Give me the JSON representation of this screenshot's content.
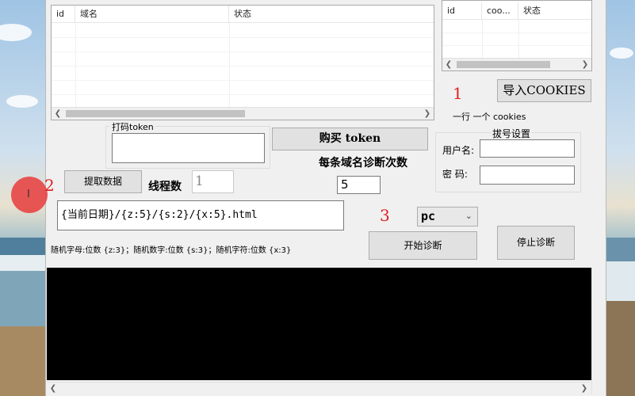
{
  "domain_list": {
    "columns": [
      "id",
      "域名",
      "状态"
    ]
  },
  "cookie_list": {
    "columns": [
      "id",
      "coo...",
      "状态"
    ]
  },
  "captcha": {
    "group_title": "打码token",
    "value": ""
  },
  "buttons": {
    "buy_token": "购买 token",
    "import_cookies": "导入COOKIES",
    "fetch_data": "提取数据",
    "start_diag": "开始诊断",
    "stop_diag": "停止诊断"
  },
  "labels": {
    "one_per_line": "一行 一个 cookies",
    "diag_count": "每条域名诊断次数",
    "thread_count": "线程数",
    "random_hint": "随机字母:位数 {z:3}；随机数字:位数 {s:3}；随机字符:位数 {x:3}"
  },
  "dial": {
    "group_title": "拔号设置",
    "username_label": "用户名:",
    "password_label": "密  码:",
    "username_value": "",
    "password_value": ""
  },
  "inputs": {
    "thread_value": "1",
    "diag_count_value": "5",
    "url_pattern": "{当前日期}/{z:5}/{s:2}/{x:5}.html",
    "device": "pc"
  },
  "annotations": [
    "1",
    "2",
    "3"
  ],
  "colors": {
    "annotation": "#e02020",
    "console_bg": "#000000",
    "window_bg": "#f0f0f0"
  }
}
